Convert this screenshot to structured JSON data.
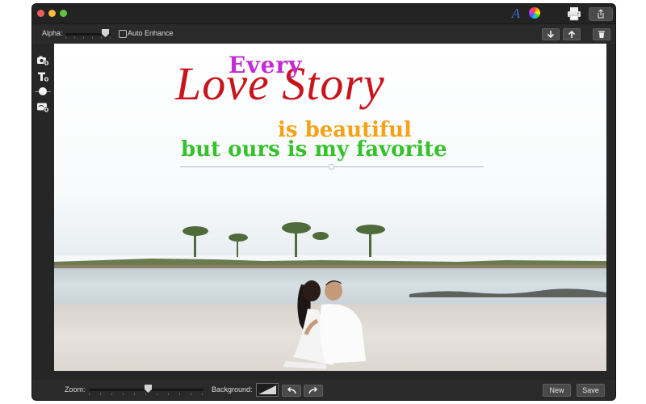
{
  "toolbar": {
    "alpha_label": "Alpha:",
    "alpha_value": 0.9,
    "auto_enhance_label": "Auto Enhance",
    "auto_enhance_checked": false
  },
  "titlebar_icons": [
    "font-icon",
    "color-wheel-icon",
    "printer-icon",
    "share-icon"
  ],
  "toolbar_icons": [
    "arrow-down-icon",
    "arrow-up-icon",
    "trash-icon"
  ],
  "left_tools": [
    "add-photo-icon",
    "add-text-icon",
    "light-icon",
    "add-sticker-icon"
  ],
  "canvas": {
    "lines": [
      {
        "text": "Every",
        "color": "#c42bd4"
      },
      {
        "text": "Love Story",
        "color": "#c8151b"
      },
      {
        "text": "is beautiful",
        "color": "#f4a319"
      },
      {
        "text": "but ours is my favorite",
        "color": "#36c12c"
      }
    ]
  },
  "bottom": {
    "zoom_label": "Zoom:",
    "zoom_value": 0.5,
    "background_label": "Background:",
    "new_label": "New",
    "save_label": "Save"
  },
  "colors": {
    "window_bg": "#262626",
    "close": "#ee5f57",
    "minimize": "#f6bd3b",
    "maximize": "#5ec63f"
  }
}
